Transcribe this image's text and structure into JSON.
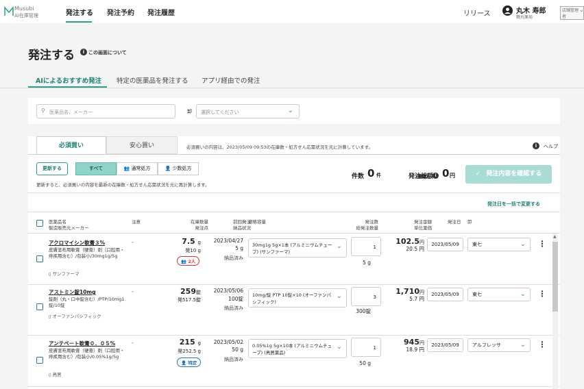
{
  "app": {
    "logo_line1": "Musubi",
    "logo_line2": "AI在庫管理",
    "nav": [
      "発注する",
      "発注予約",
      "発注履歴"
    ],
    "release": "リリース",
    "user_name": "丸木 寿郎",
    "user_role": "店舗管理者",
    "user_store": "鶴丸薬局"
  },
  "page": {
    "title": "発注する",
    "info_link": "この画面について",
    "tabs": [
      "AIによるおすすめ発注",
      "特定の医薬品を発注する",
      "アプリ経由での発注"
    ]
  },
  "search": {
    "placeholder": "医薬品名、メーカー",
    "wholesaler_label": "卸",
    "wholesaler_placeholder": "選択してください"
  },
  "panel": {
    "tab_required": "必須買い",
    "tab_safe": "安心買い",
    "tab_note": "必須買いの内容は、2023/05/09 09:53の在庫数・処方せん応需状況を元に計算しています。",
    "help": "ヘルプ",
    "refresh_button": "更新する",
    "filters": [
      "すべて",
      "通常処方",
      "少数処方"
    ],
    "refresh_note": "更新すると、必須買いの内容を最新の在庫数・処方せん応需状況を元に再計算します。",
    "count_label": "件数",
    "count_value": "0",
    "count_unit": "件",
    "total_label": "発注総額",
    "total_sub": "(薬価)",
    "total_value": "0",
    "total_unit": "円",
    "confirm_button": "発注内容を確認する",
    "bulk_date_link": "発注日を一括で変更する"
  },
  "headers": {
    "name_1": "医薬品名",
    "name_2": "製造販売元メーカー",
    "note": "注意",
    "stock_1": "在庫数量",
    "stock_2": "発注点",
    "last_1": "前回発注",
    "last_2": "納品状況",
    "pack": "規格容量",
    "qty_1": "発注数",
    "qty_2": "総発注数量",
    "amount_1": "発注金額",
    "amount_2": "単位薬価",
    "date": "発注日",
    "wholesaler": "卸"
  },
  "rows": [
    {
      "name": "アクロマイシン軟膏３%",
      "desc": "皮膚塗布用軟膏（硬膏）剤（口腔用・痔疾用含む）/包装小/30mg1g/5g",
      "maker": "サンファーマ",
      "note": "-",
      "stock": "7.5",
      "stock_unit": "g",
      "reorder": "発10 g",
      "badge": "2人",
      "last_date": "2023/04/27",
      "last_qty": "5 g",
      "delivery": "納品済み",
      "pack": "30mg1g 5g×1本 (アルミニウムチューブ) (サンファーマ)",
      "qty": "1",
      "qty_total": "5 g",
      "amount": "102.5",
      "amount_unit": "円",
      "unit_price": "20.5 円",
      "order_date": "2023/05/09",
      "wholesaler": "東七"
    },
    {
      "name": "アストミン錠10mg",
      "desc": "錠剤（丸・口中錠含む）/PTP/10mg1錠/10錠",
      "maker": "オーファンパシフィック",
      "note": "-",
      "stock": "259",
      "stock_unit": "錠",
      "reorder": "発517.5錠",
      "badge": "",
      "last_date": "2023/05/06",
      "last_qty": "100錠",
      "delivery": "納品済み",
      "pack": "10mg/錠 PTP 10錠×10 (オーファンパシフィック)",
      "qty": "3",
      "qty_total": "300錠",
      "amount": "1,710",
      "amount_unit": "円",
      "unit_price": "5.7 円",
      "order_date": "2023/05/09",
      "wholesaler": "東七"
    },
    {
      "name": "アンテベート軟膏０．０５%",
      "desc": "皮膚塗布用軟膏（硬膏）剤（口腔用・痔疾用含む）/包装小/0.05%1g/5g",
      "maker": "鳥居",
      "note": "-",
      "stock": "215",
      "stock_unit": "g",
      "reorder": "発252.5 g",
      "badge": "特定",
      "last_date": "2023/05/02",
      "last_qty": "50 g",
      "delivery": "納品済み",
      "pack": "0.05%1g 5g×10本 (アルミニウムチューブ) (鳥居薬品)",
      "qty": "1",
      "qty_total": "50 g",
      "amount": "945",
      "amount_unit": "円",
      "unit_price": "18.9 円",
      "order_date": "2023/05/09",
      "wholesaler": "アルフレッサ"
    }
  ],
  "colors": {
    "accent": "#2a9d8f",
    "confirm_disabled": "#a8dcd4",
    "alert": "#d33333",
    "info": "#2c6fb8"
  }
}
